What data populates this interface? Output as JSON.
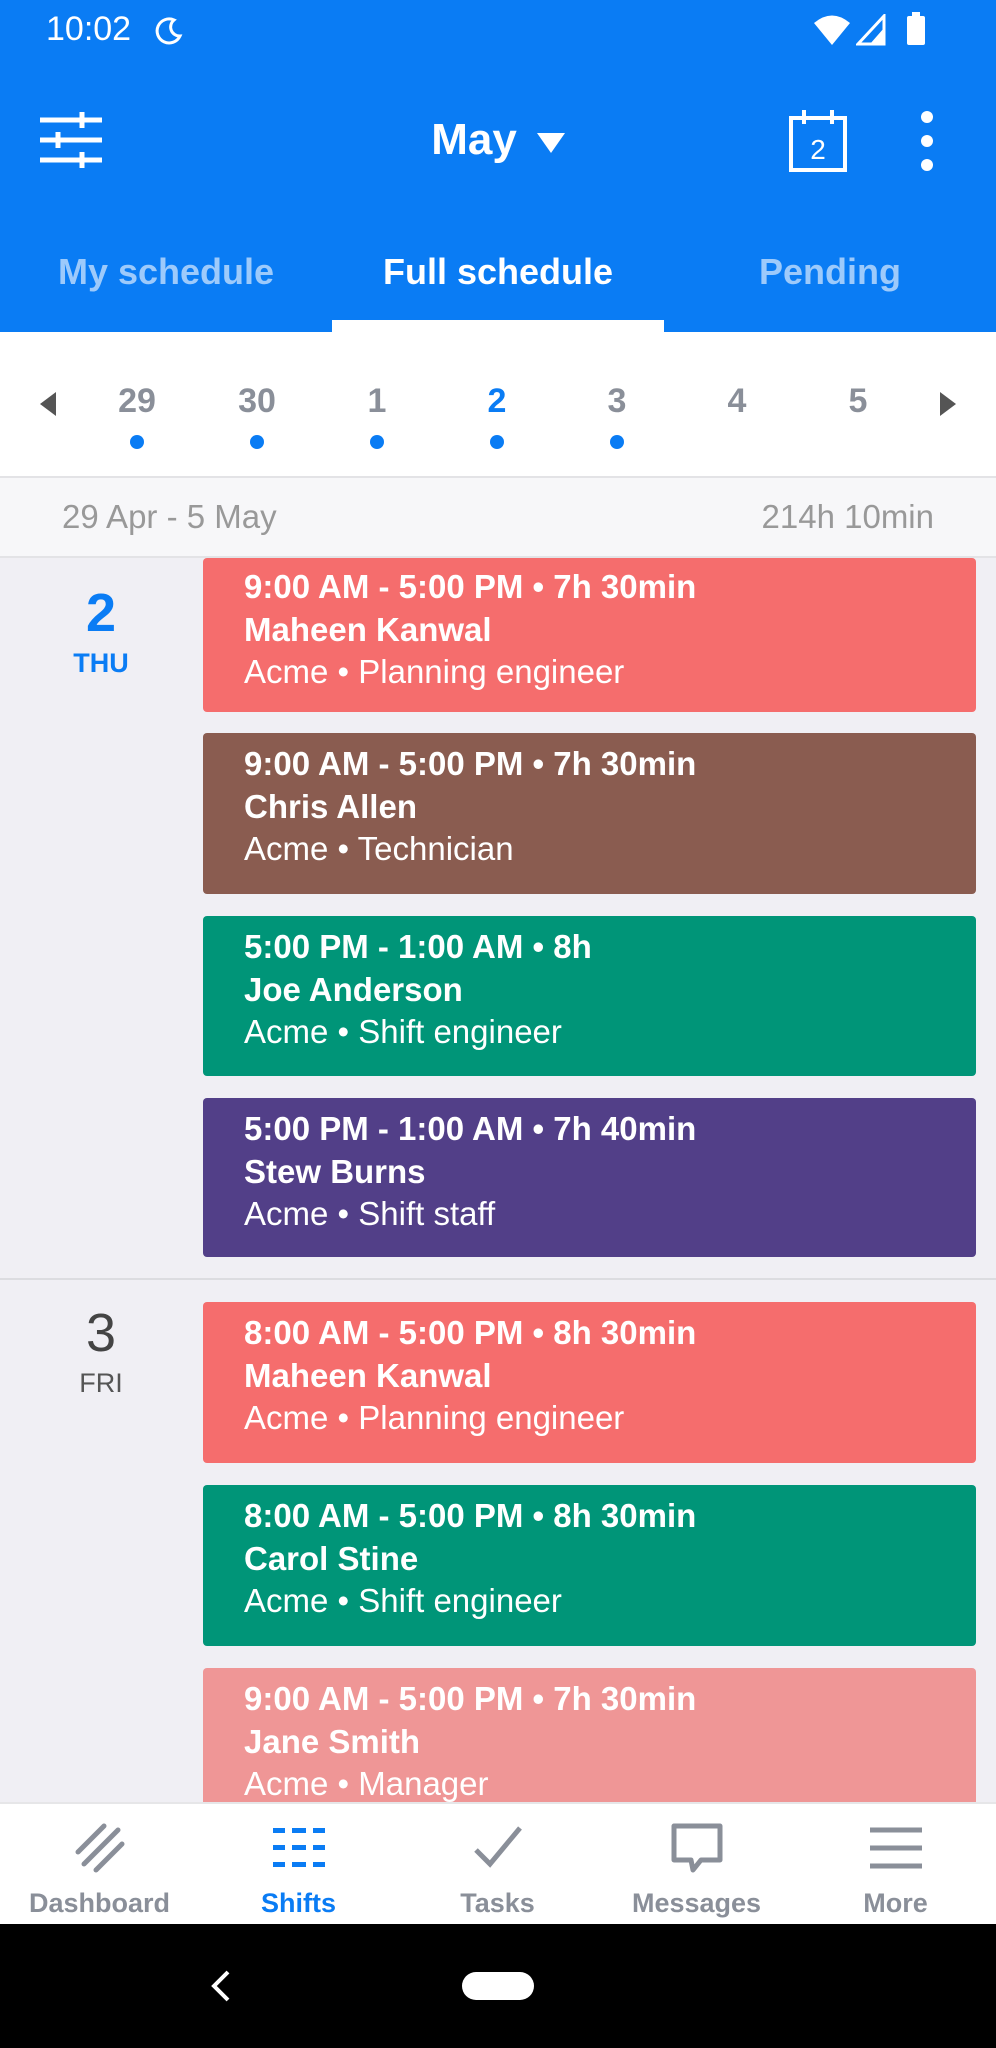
{
  "status_bar": {
    "time": "10:02"
  },
  "toolbar": {
    "month": "May",
    "calendar_day": "2"
  },
  "tabs": [
    {
      "label": "My schedule"
    },
    {
      "label": "Full schedule"
    },
    {
      "label": "Pending"
    }
  ],
  "day_strip": [
    {
      "num": "29",
      "has_shift": true
    },
    {
      "num": "30",
      "has_shift": true
    },
    {
      "num": "1",
      "has_shift": true
    },
    {
      "num": "2",
      "has_shift": true,
      "selected": true
    },
    {
      "num": "3",
      "has_shift": true
    },
    {
      "num": "4",
      "has_shift": false
    },
    {
      "num": "5",
      "has_shift": false
    }
  ],
  "week": {
    "range": "29 Apr - 5 May",
    "total": "214h 10min"
  },
  "days": [
    {
      "num": "2",
      "dow": "THU",
      "shifts": [
        {
          "time": "9:00 AM - 5:00 PM • 7h 30min",
          "name": "Maheen Kanwal",
          "company": "Acme",
          "role": "Planning engineer",
          "color": "#f56d6d"
        },
        {
          "time": "9:00 AM - 5:00 PM • 7h 30min",
          "name": "Chris Allen",
          "company": "Acme",
          "role": "Technician",
          "color": "#8a5c50"
        },
        {
          "time": "5:00 PM - 1:00 AM • 8h",
          "name": "Joe Anderson",
          "company": "Acme",
          "role": "Shift engineer",
          "color": "#009578"
        },
        {
          "time": "5:00 PM - 1:00 AM • 7h 40min",
          "name": "Stew Burns",
          "company": "Acme",
          "role": "Shift staff",
          "color": "#523f88"
        }
      ]
    },
    {
      "num": "3",
      "dow": "FRI",
      "shifts": [
        {
          "time": "8:00 AM - 5:00 PM • 8h 30min",
          "name": "Maheen Kanwal",
          "company": "Acme",
          "role": "Planning engineer",
          "color": "#f56d6d"
        },
        {
          "time": "8:00 AM - 5:00 PM • 8h 30min",
          "name": "Carol Stine",
          "company": "Acme",
          "role": "Shift engineer",
          "color": "#009578"
        },
        {
          "time": "9:00 AM - 5:00 PM • 7h 30min",
          "name": "Jane Smith",
          "company": "Acme",
          "role": "Manager",
          "color": "#ef9696"
        }
      ]
    }
  ],
  "bottom_nav": [
    {
      "label": "Dashboard",
      "icon": "dashboard-icon"
    },
    {
      "label": "Shifts",
      "icon": "shifts-icon",
      "active": true
    },
    {
      "label": "Tasks",
      "icon": "checkmark-icon"
    },
    {
      "label": "Messages",
      "icon": "chat-bubble-icon"
    },
    {
      "label": "More",
      "icon": "menu-icon"
    }
  ],
  "colors": {
    "brand_blue": "#0a7cf4"
  }
}
